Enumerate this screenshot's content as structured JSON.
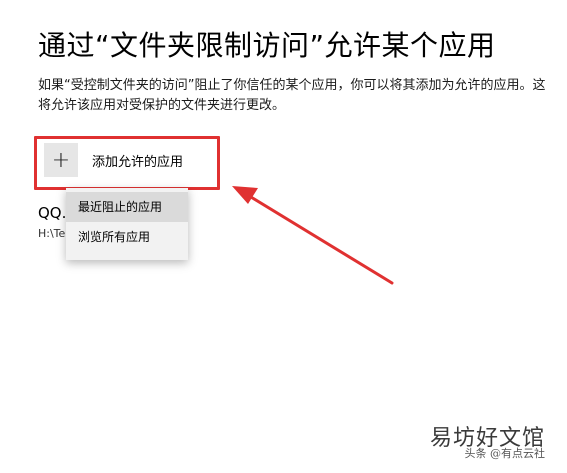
{
  "header": {
    "title": "通过“文件夹限制访问”允许某个应用",
    "description": "如果“受控制文件夹的访问”阻止了你信任的某个应用，你可以将其添加为允许的应用。这将允许该应用对受保护的文件夹进行更改。"
  },
  "add_button": {
    "icon": "plus-icon",
    "plus_glyph": "+",
    "label": "添加允许的应用"
  },
  "app_entry": {
    "name": "QQ.",
    "path": "H:\\Te"
  },
  "menu": {
    "items": [
      {
        "label": "最近阻止的应用"
      },
      {
        "label": "浏览所有应用"
      }
    ]
  },
  "annotation": {
    "highlight_color": "#e03131",
    "arrow_color": "#e03131"
  },
  "watermark": {
    "main": "易坊好文馆",
    "sub": "头条 @有点云社"
  }
}
